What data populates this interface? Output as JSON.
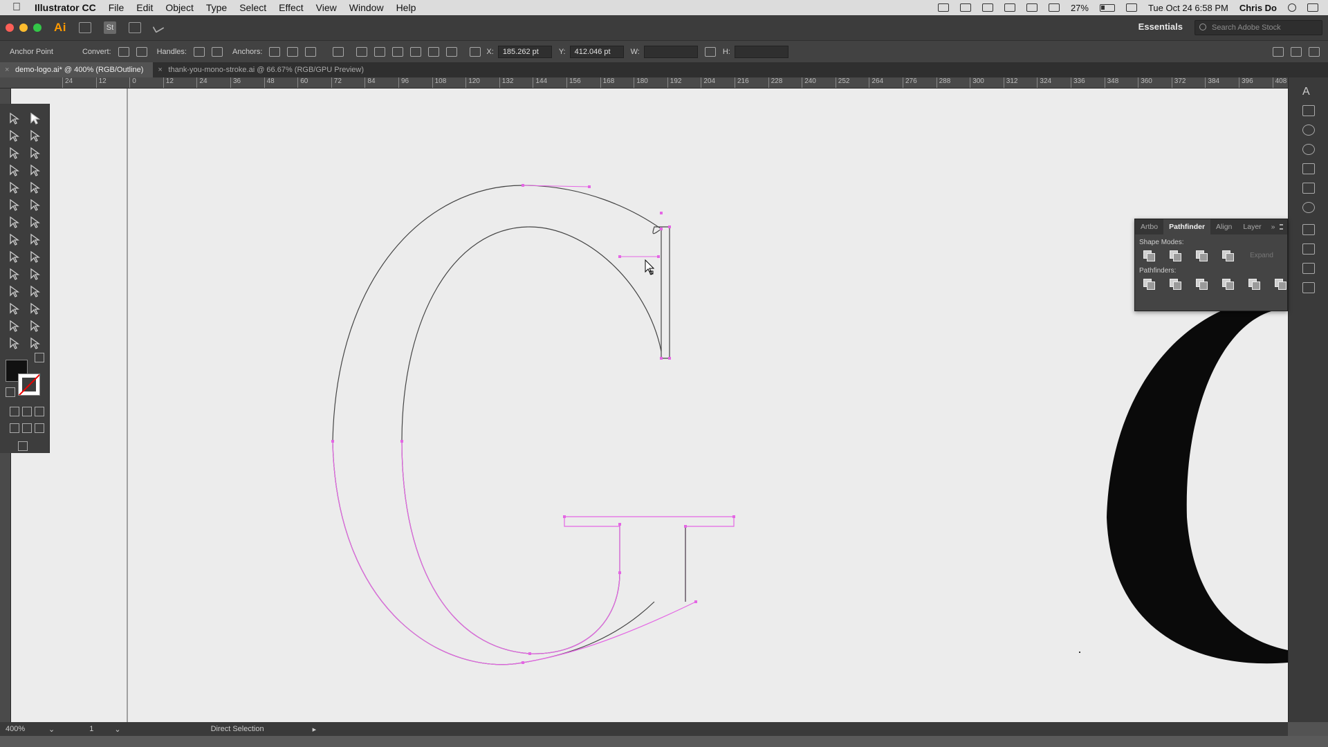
{
  "menubar": {
    "app_name": "Illustrator CC",
    "items": [
      "File",
      "Edit",
      "Object",
      "Type",
      "Select",
      "Effect",
      "View",
      "Window",
      "Help"
    ],
    "battery": "27%",
    "datetime": "Tue Oct 24  6:58 PM",
    "user": "Chris Do"
  },
  "appbar": {
    "logo": "Ai",
    "st_badge": "St",
    "workspace": "Essentials",
    "stock_search_placeholder": "Search Adobe Stock"
  },
  "control": {
    "tool_label": "Anchor Point",
    "convert_label": "Convert:",
    "handles_label": "Handles:",
    "anchors_label": "Anchors:",
    "x_label": "X:",
    "x_value": "185.262 pt",
    "y_label": "Y:",
    "y_value": "412.046 pt",
    "w_label": "W:",
    "w_value": "",
    "h_label": "H:",
    "h_value": ""
  },
  "tabs": [
    {
      "label": "demo-logo.ai* @ 400% (RGB/Outline)",
      "active": true
    },
    {
      "label": "thank-you-mono-stroke.ai @ 66.67% (RGB/GPU Preview)",
      "active": false
    }
  ],
  "ruler": {
    "labels": [
      "24",
      "12",
      "0",
      "12",
      "24",
      "36",
      "48",
      "60",
      "72",
      "84",
      "96",
      "108",
      "120",
      "132",
      "144",
      "156",
      "168",
      "180",
      "192",
      "204",
      "216",
      "228",
      "240",
      "252",
      "264",
      "276",
      "288",
      "300",
      "312",
      "324",
      "336",
      "348",
      "360",
      "372",
      "384",
      "396",
      "408"
    ]
  },
  "pathfinder_panel": {
    "tabs": [
      "Artbo",
      "Pathfinder",
      "Align",
      "Layer"
    ],
    "active_tab": "Pathfinder",
    "more": "»",
    "shape_modes_label": "Shape Modes:",
    "expand_label": "Expand",
    "pathfinders_label": "Pathfinders:"
  },
  "status": {
    "zoom": "400%",
    "page": "1",
    "mode": "Direct Selection"
  },
  "colors": {
    "path_selection": "#e466e4",
    "outline": "#333333",
    "canvas": "#ececec",
    "fill_swatch": "#111111"
  }
}
